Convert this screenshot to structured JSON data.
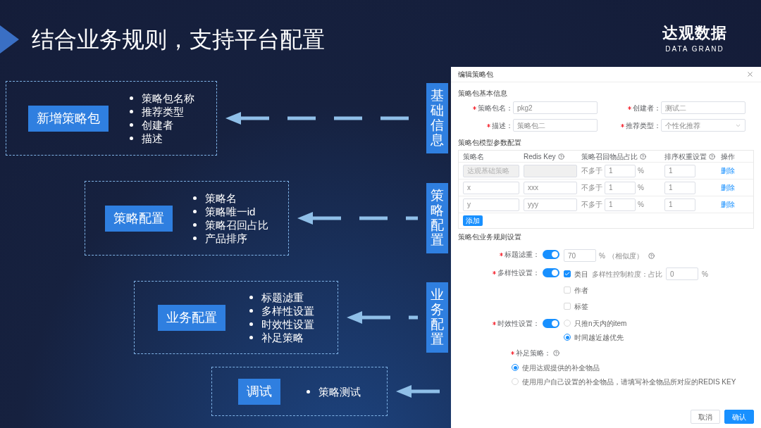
{
  "title": "结合业务规则，支持平台配置",
  "logo": {
    "name": "达观数据",
    "tagline": "DATA GRAND"
  },
  "modules": [
    {
      "label": "新增策略包",
      "items": [
        "策略包名称",
        "推荐类型",
        "创建者",
        "描述"
      ],
      "source": "基础信息"
    },
    {
      "label": "策略配置",
      "items": [
        "策略名",
        "策略唯一id",
        "策略召回占比",
        "产品排序"
      ],
      "source": "策略配置"
    },
    {
      "label": "业务配置",
      "items": [
        "标题滤重",
        "多样性设置",
        "时效性设置",
        "补足策略"
      ],
      "source": "业务配置"
    },
    {
      "label": "调试",
      "items": [
        "策略测试"
      ]
    }
  ],
  "dialog": {
    "title": "编辑策略包",
    "basic": {
      "title": "策略包基本信息",
      "fields": [
        {
          "label": "策略包名：",
          "value": "pkg2",
          "required": true,
          "kind": "text"
        },
        {
          "label": "创建者：",
          "value": "测试二",
          "required": true,
          "kind": "text"
        },
        {
          "label": "描述：",
          "value": "策略包二",
          "required": true,
          "kind": "text"
        },
        {
          "label": "推荐类型：",
          "value": "个性化推荐",
          "required": true,
          "kind": "select"
        }
      ]
    },
    "model": {
      "title": "策略包模型参数配置",
      "columns": [
        {
          "label": "策略名",
          "help": false
        },
        {
          "label": "Redis Key",
          "help": true
        },
        {
          "label": "策略召回物品占比",
          "help": true
        },
        {
          "label": "排序权重设置",
          "help": true
        },
        {
          "label": "操作",
          "help": false
        }
      ],
      "rows": [
        {
          "name": "达观基础策略",
          "disabled": true,
          "limit": "不多于",
          "ratio": "1",
          "unit": "%",
          "weight": "1",
          "action": "删除"
        },
        {
          "name": "x",
          "redis_key": "xxx",
          "disabled": false,
          "limit": "不多于",
          "ratio": "1",
          "unit": "%",
          "weight": "1",
          "action": "删除"
        },
        {
          "name": "y",
          "redis_key": "yyy",
          "disabled": false,
          "limit": "不多于",
          "ratio": "1",
          "unit": "%",
          "weight": "1",
          "action": "删除"
        }
      ],
      "add_button": "添加"
    },
    "rules": {
      "title": "策略包业务规则设置",
      "items": [
        {
          "kind": "threshold",
          "label": "标题滤重：",
          "required": true,
          "on": true,
          "value": "70",
          "unit": "%",
          "note": "（相似度）"
        },
        {
          "kind": "checkboxes",
          "label": "多样性设置：",
          "required": true,
          "on": true,
          "options": [
            {
              "label": "类目",
              "checked": true,
              "extra": "多样性控制粒度：占比",
              "value": "0",
              "unit": "%"
            },
            {
              "label": "作者",
              "checked": false
            },
            {
              "label": "标签",
              "checked": false
            }
          ]
        },
        {
          "kind": "radios",
          "label": "时效性设置：",
          "required": true,
          "on": true,
          "options": [
            {
              "label": "只推n天内的item",
              "selected": false
            },
            {
              "label": "时间越近越优先",
              "selected": true
            }
          ]
        },
        {
          "kind": "radios",
          "label": "补足策略：",
          "required": true,
          "help": true,
          "options": [
            {
              "label": "使用达观提供的补全物品",
              "selected": true
            },
            {
              "label": "使用用户自己设置的补全物品，请填写补全物品所对应的REDIS KEY",
              "selected": false
            }
          ]
        }
      ]
    },
    "buttons": [
      {
        "label": "取消",
        "kind": "default"
      },
      {
        "label": "确认",
        "kind": "primary"
      }
    ]
  }
}
